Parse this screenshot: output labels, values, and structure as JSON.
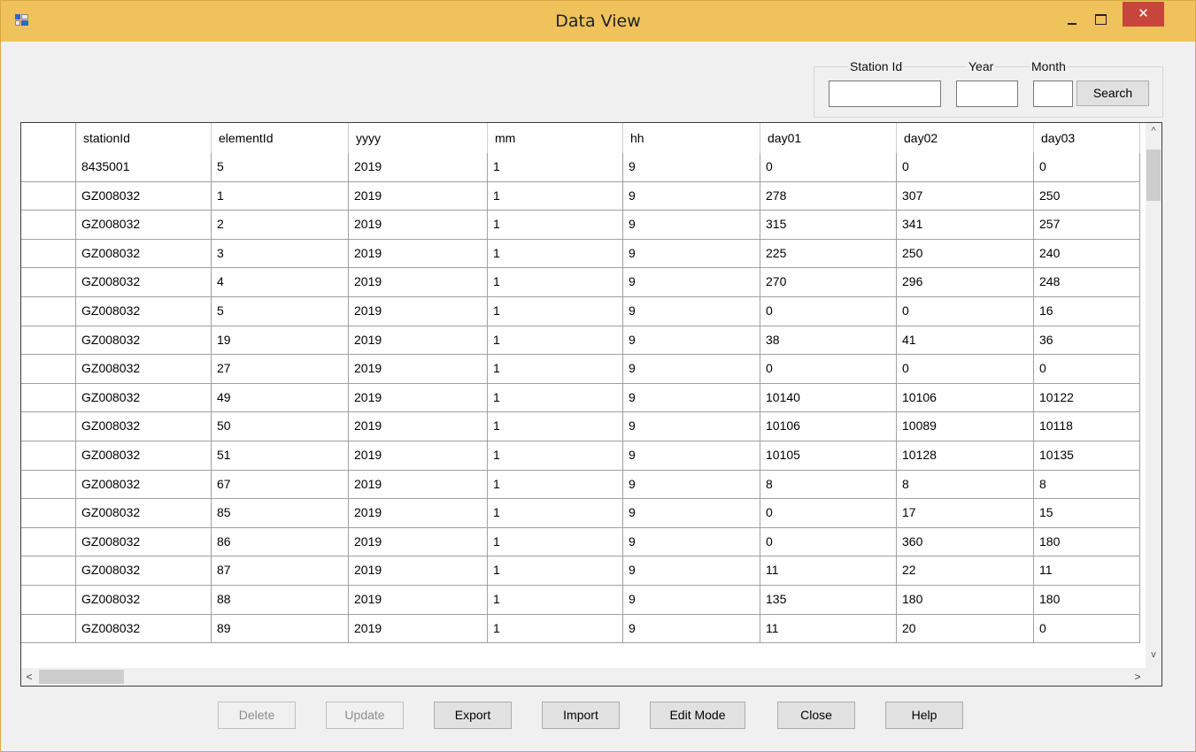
{
  "window": {
    "title": "Data View",
    "controls": {
      "minimize": "minimize-icon",
      "maximize": "maximize-icon",
      "close": "✕"
    }
  },
  "search": {
    "station_label": "Station Id",
    "year_label": "Year",
    "month_label": "Month",
    "station_value": "",
    "year_value": "",
    "month_value": "",
    "button_label": "Search"
  },
  "grid": {
    "columns": [
      "stationId",
      "elementId",
      "yyyy",
      "mm",
      "hh",
      "day01",
      "day02",
      "day03"
    ],
    "rows": [
      [
        "8435001",
        "5",
        "2019",
        "1",
        "9",
        "0",
        "0",
        "0"
      ],
      [
        "GZ008032",
        "1",
        "2019",
        "1",
        "9",
        "278",
        "307",
        "250"
      ],
      [
        "GZ008032",
        "2",
        "2019",
        "1",
        "9",
        "315",
        "341",
        "257"
      ],
      [
        "GZ008032",
        "3",
        "2019",
        "1",
        "9",
        "225",
        "250",
        "240"
      ],
      [
        "GZ008032",
        "4",
        "2019",
        "1",
        "9",
        "270",
        "296",
        "248"
      ],
      [
        "GZ008032",
        "5",
        "2019",
        "1",
        "9",
        "0",
        "0",
        "16"
      ],
      [
        "GZ008032",
        "19",
        "2019",
        "1",
        "9",
        "38",
        "41",
        "36"
      ],
      [
        "GZ008032",
        "27",
        "2019",
        "1",
        "9",
        "0",
        "0",
        "0"
      ],
      [
        "GZ008032",
        "49",
        "2019",
        "1",
        "9",
        "10140",
        "10106",
        "10122"
      ],
      [
        "GZ008032",
        "50",
        "2019",
        "1",
        "9",
        "10106",
        "10089",
        "10118"
      ],
      [
        "GZ008032",
        "51",
        "2019",
        "1",
        "9",
        "10105",
        "10128",
        "10135"
      ],
      [
        "GZ008032",
        "67",
        "2019",
        "1",
        "9",
        "8",
        "8",
        "8"
      ],
      [
        "GZ008032",
        "85",
        "2019",
        "1",
        "9",
        "0",
        "17",
        "15"
      ],
      [
        "GZ008032",
        "86",
        "2019",
        "1",
        "9",
        "0",
        "360",
        "180"
      ],
      [
        "GZ008032",
        "87",
        "2019",
        "1",
        "9",
        "11",
        "22",
        "11"
      ],
      [
        "GZ008032",
        "88",
        "2019",
        "1",
        "9",
        "135",
        "180",
        "180"
      ],
      [
        "GZ008032",
        "89",
        "2019",
        "1",
        "9",
        "11",
        "20",
        "0"
      ]
    ]
  },
  "scroll": {
    "up": "^",
    "down": "v",
    "left": "<",
    "right": ">"
  },
  "buttons": {
    "delete": "Delete",
    "update": "Update",
    "export": "Export",
    "import": "Import",
    "edit_mode": "Edit Mode",
    "close": "Close",
    "help": "Help"
  }
}
